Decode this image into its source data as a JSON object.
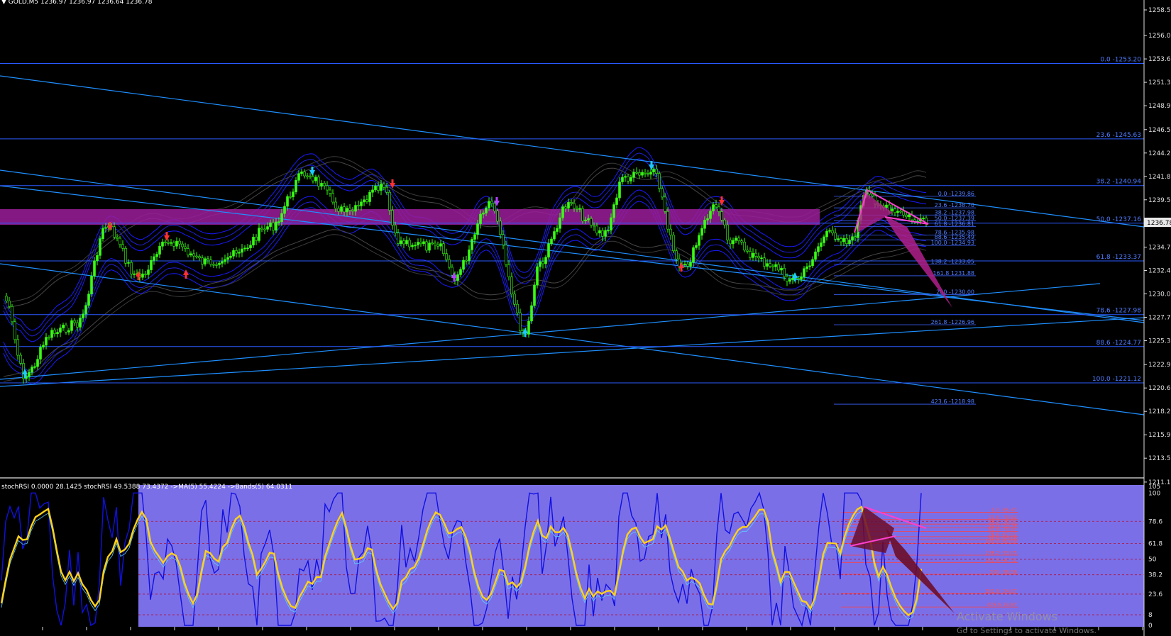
{
  "header": {
    "symbol_line": "▼ GOLD,M5  1236.97 1236.97 1236.64 1236.78"
  },
  "price_axis": {
    "labels": [
      "1258.58",
      "1256.01",
      "1253.66",
      "1251.31",
      "1248.96",
      "1246.56",
      "1244.21",
      "1241.86",
      "1239.51",
      "1237.16",
      "1234.76",
      "1232.41",
      "1230.06",
      "1227.71",
      "1225.36",
      "1222.96",
      "1220.61",
      "1218.26",
      "1215.91",
      "1213.56",
      "1211.16"
    ],
    "current_price": "1236.78"
  },
  "fib_main": [
    {
      "label": "0.0 -1253.20",
      "price": 1253.2
    },
    {
      "label": "23.6 -1245.63",
      "price": 1245.63
    },
    {
      "label": "38.2 -1240.94",
      "price": 1240.94
    },
    {
      "label": "50.0 -1237.16",
      "price": 1237.16
    },
    {
      "label": "61.8 -1233.37",
      "price": 1233.37
    },
    {
      "label": "78.6 -1227.98",
      "price": 1227.98
    },
    {
      "label": "88.6 -1224.77",
      "price": 1224.77
    },
    {
      "label": "100.0 -1221.12",
      "price": 1221.12
    }
  ],
  "fib_small": [
    {
      "label": "0.0 -1239.86",
      "price": 1239.86
    },
    {
      "label": "23.6 -1238.70",
      "price": 1238.7
    },
    {
      "label": "38.2 -1237.98",
      "price": 1237.98
    },
    {
      "label": "50.0 -1237.39",
      "price": 1237.39
    },
    {
      "label": "61.8 -1236.81",
      "price": 1236.81
    },
    {
      "label": "78.6 -1235.98",
      "price": 1235.98
    },
    {
      "label": "88.6 -1235.49",
      "price": 1235.49
    },
    {
      "label": "100.0 -1234.93",
      "price": 1234.93
    },
    {
      "label": "138.2 -1233.05",
      "price": 1233.05
    },
    {
      "label": "161.8 1231.88",
      "price": 1231.88
    },
    {
      "label": "200 -1230.00",
      "price": 1230.0
    },
    {
      "label": "261.8 -1226.96",
      "price": 1226.96
    },
    {
      "label": "423.6 -1218.98",
      "price": 1218.98
    }
  ],
  "indicator": {
    "header": "stochRSI 0.0000 28.1425  stochRSI 49.5388 73.4372  ->MA(5) 55.4224  ->Bands(5) 64.0311",
    "levels": [
      {
        "label": "105",
        "value": 105
      },
      {
        "label": "100",
        "value": 100
      },
      {
        "label": "78.6",
        "value": 78.6
      },
      {
        "label": "61.8",
        "value": 61.8
      },
      {
        "label": "50",
        "value": 50
      },
      {
        "label": "38.2",
        "value": 38.2
      },
      {
        "label": "23.6",
        "value": 23.6
      },
      {
        "label": "8",
        "value": 8
      },
      {
        "label": "0",
        "value": 0
      }
    ],
    "fib_labels": [
      "0.0 -85.47",
      "23.6 -79.93",
      "38.2 -76.51",
      "50.0 -73.74",
      "61.8 -70.97",
      "78.6 -67.03",
      "88.6 -64.68",
      "100.0 -62.00",
      "138.2 -53.05",
      "161.8 -47.52",
      "200 -38.56",
      "261.8 -24.07",
      "423.6 13.87"
    ]
  },
  "watermark": {
    "title": "Activate Windows",
    "subtitle": "Go to Settings to activate Windows."
  },
  "colors": {
    "background": "#000000",
    "bull_candle": "#39ff14",
    "band": "#1a1aff",
    "trend": "#2a7fff",
    "zone": "#9b1d9b",
    "pattern": "#c02a9c",
    "panel_bg": "#7b6fe8",
    "stoch_fast": "#1010e0",
    "stoch_slow": "#ffd21a"
  }
}
